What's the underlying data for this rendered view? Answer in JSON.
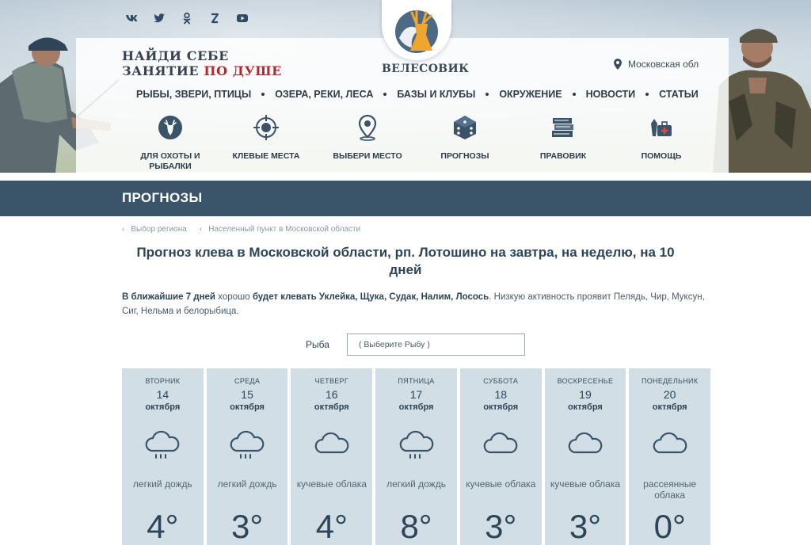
{
  "header": {
    "social": [
      "vk",
      "twitter",
      "ok",
      "zen",
      "youtube"
    ],
    "slogan_line1": "НАЙДИ СЕБЕ",
    "slogan_line2_a": "ЗАНЯТИЕ ",
    "slogan_line2_b": "ПО ДУШЕ",
    "logo_name": "ВЕЛЕСОВИК",
    "location": "Московская обл",
    "main_nav": [
      "РЫБЫ, ЗВЕРИ, ПТИЦЫ",
      "ОЗЕРА, РЕКИ, ЛЕСА",
      "БАЗЫ И КЛУБЫ",
      "ОКРУЖЕНИЕ",
      "НОВОСТИ",
      "СТАТЬИ"
    ],
    "categories": [
      {
        "icon": "deer-icon",
        "label": "ДЛЯ ОХОТЫ И РЫБАЛКИ"
      },
      {
        "icon": "target-icon",
        "label": "КЛЕВЫЕ МЕСТА"
      },
      {
        "icon": "map-pin-icon",
        "label": "ВЫБЕРИ МЕСТО"
      },
      {
        "icon": "dice-icon",
        "label": "ПРОГНОЗЫ"
      },
      {
        "icon": "books-icon",
        "label": "ПРАВОВИК"
      },
      {
        "icon": "first-aid-icon",
        "label": "ПОМОЩЬ"
      }
    ]
  },
  "titlebar": {
    "title": "ПРОГНОЗЫ"
  },
  "breadcrumb": [
    "Выбор региона",
    "Населенный пункт в Московской области"
  ],
  "page_title": "Прогноз клева в Московской области, рп. Лотошино на завтра, на неделю, на 10 дней",
  "description": {
    "a": "В ближайшие 7 дней",
    "b": " хорошо ",
    "c": "будет клевать Уклейка, Щука, Судак, Налим, Лосось",
    "d": ". Низкую активность проявит Пелядь, Чир, Муксун, Сиг, Нельма и белорыбица."
  },
  "fish_select": {
    "label": "Рыба",
    "value": "( Выберите Рыбу )"
  },
  "forecast": [
    {
      "dow": "ВТОРНИК",
      "day": "14",
      "month": "октября",
      "icon": "rain-cloud-icon",
      "condition": "легкий дождь",
      "temp": "4°"
    },
    {
      "dow": "СРЕДА",
      "day": "15",
      "month": "октября",
      "icon": "rain-cloud-icon",
      "condition": "легкий дождь",
      "temp": "3°"
    },
    {
      "dow": "ЧЕТВЕРГ",
      "day": "16",
      "month": "октября",
      "icon": "cloud-icon",
      "condition": "кучевые облака",
      "temp": "4°"
    },
    {
      "dow": "ПЯТНИЦА",
      "day": "17",
      "month": "октября",
      "icon": "rain-cloud-icon",
      "condition": "легкий дождь",
      "temp": "8°"
    },
    {
      "dow": "СУББОТА",
      "day": "18",
      "month": "октября",
      "icon": "cloud-icon",
      "condition": "кучевые облака",
      "temp": "3°"
    },
    {
      "dow": "ВОСКРЕСЕНЬЕ",
      "day": "19",
      "month": "октября",
      "icon": "cloud-icon",
      "condition": "кучевые облака",
      "temp": "3°"
    },
    {
      "dow": "ПОНЕДЕЛЬНИК",
      "day": "20",
      "month": "октября",
      "icon": "cloud-icon",
      "condition": "рассеянные облака",
      "temp": "0°"
    }
  ],
  "colors": {
    "title_bar": "#3a546a",
    "forecast_card": "#d2dee6",
    "slogan_red": "#b6272c",
    "logo_orange": "#f0a530"
  }
}
